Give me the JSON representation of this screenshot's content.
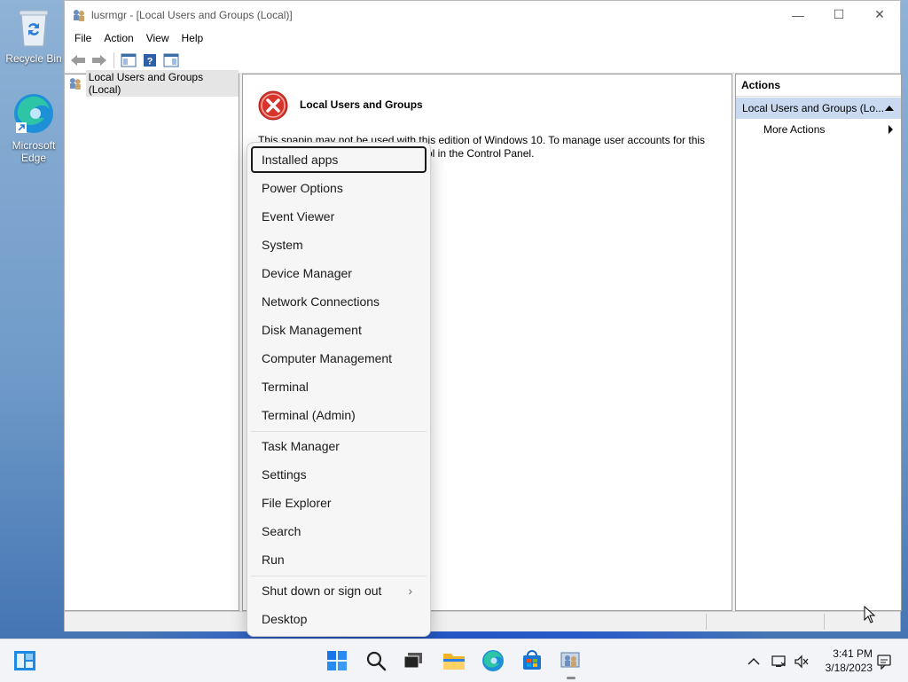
{
  "desktop": {
    "icons": [
      {
        "label": "Recycle Bin",
        "icon": "recycle-bin-icon"
      },
      {
        "label": "Microsoft Edge",
        "icon": "edge-icon"
      }
    ]
  },
  "window": {
    "title": "lusrmgr - [Local Users and Groups (Local)]",
    "controls": {
      "minimize": "—",
      "maximize": "☐",
      "close": "✕"
    },
    "menu": [
      "File",
      "Action",
      "View",
      "Help"
    ],
    "toolbar_icons": [
      "back-arrow-icon",
      "forward-arrow-icon",
      "show-hide-tree-icon",
      "help-icon",
      "action-pane-icon"
    ]
  },
  "tree": {
    "root": "Local Users and Groups (Local)"
  },
  "center": {
    "title": "Local Users and Groups",
    "message_line1": "This snapin may not be used with this edition of Windows 10. To manage user accounts for this",
    "message_line2": "ol in the Control Panel."
  },
  "actions": {
    "header": "Actions",
    "selected": "Local Users and Groups (Lo...",
    "more": "More Actions"
  },
  "winx_menu": {
    "items": [
      "Installed apps",
      "Power Options",
      "Event Viewer",
      "System",
      "Device Manager",
      "Network Connections",
      "Disk Management",
      "Computer Management",
      "Terminal",
      "Terminal (Admin)",
      "Task Manager",
      "Settings",
      "File Explorer",
      "Search",
      "Run",
      "Shut down or sign out",
      "Desktop"
    ],
    "focused": "Installed apps"
  },
  "taskbar": {
    "apps": [
      "widgets-icon",
      "start-icon",
      "search-icon",
      "task-view-icon",
      "file-explorer-icon",
      "edge-icon",
      "store-icon",
      "lusrmgr-icon"
    ],
    "clock_time": "3:41 PM",
    "clock_date": "3/18/2023"
  },
  "colors": {
    "accent": "#0067c0",
    "selection": "#c9d9ef",
    "error_red": "#d9342b"
  }
}
